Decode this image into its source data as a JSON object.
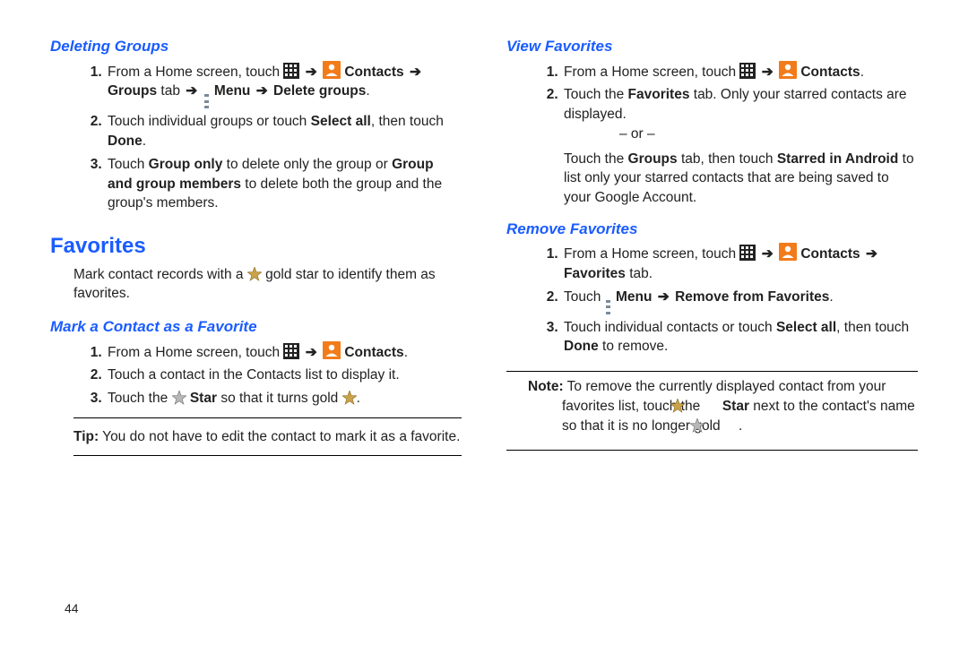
{
  "left": {
    "deleting_groups": {
      "heading": "Deleting Groups",
      "s1a": "From a Home screen, touch ",
      "contacts": "Contacts",
      "groups_tab": "Groups",
      "tab_word": " tab ",
      "menu": "Menu",
      "delete_groups": "Delete groups",
      "s2a": "Touch individual groups or touch ",
      "select_all": "Select all",
      "s2b": ", then touch ",
      "done": "Done",
      "s3a": "Touch ",
      "group_only": "Group only",
      "s3b": " to delete only the group or ",
      "group_and": "Group and group members",
      "s3c": " to delete both the group and the group's members."
    },
    "favorites": {
      "heading": "Favorites",
      "intro_a": "Mark contact records with a ",
      "intro_b": " gold star to identify them as favorites."
    },
    "mark": {
      "heading": "Mark a Contact as a Favorite",
      "s1": "From a Home screen, touch ",
      "contacts": "Contacts",
      "s2": "Touch a contact in the Contacts list to display it.",
      "s3a": "Touch the ",
      "star": "Star",
      "s3b": " so that it turns gold "
    },
    "tip_label": "Tip:",
    "tip_text": " You do not have to edit the contact to mark it as a favorite."
  },
  "right": {
    "view": {
      "heading": "View Favorites",
      "s1": "From a Home screen, touch ",
      "contacts": "Contacts",
      "s2a": "Touch the ",
      "fav": "Favorites",
      "s2b": " tab. Only your starred contacts are displayed.",
      "or": "– or –",
      "alt_a": "Touch the ",
      "groups": "Groups",
      "alt_b": " tab, then touch ",
      "starred": "Starred in Android",
      "alt_c": " to list only your starred contacts that are being saved to your Google Account."
    },
    "remove": {
      "heading": "Remove Favorites",
      "s1": "From a Home screen, touch ",
      "contacts": "Contacts",
      "fav_tab": "Favorites",
      "tab_word": " tab.",
      "s2a": "Touch ",
      "menu": "Menu",
      "remove": "Remove from Favorites",
      "s3a": "Touch individual contacts or touch ",
      "select_all": "Select all",
      "s3b": ", then touch ",
      "done": "Done",
      "s3c": " to remove."
    },
    "note_label": "Note:",
    "note_a": " To remove the currently displayed contact from your favorites list, touch the ",
    "note_star": "Star",
    "note_b": " next to the contact's name so that it is no longer gold "
  },
  "page": "44",
  "glyphs": {
    "arrow": "➔"
  }
}
